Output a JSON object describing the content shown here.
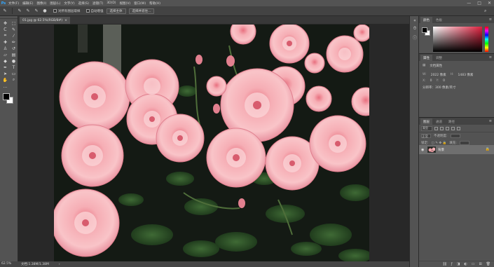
{
  "menubar": {
    "logo": "Ps",
    "items": [
      "文件(F)",
      "编辑(E)",
      "图像(I)",
      "图层(L)",
      "文字(Y)",
      "选择(S)",
      "滤镜(T)",
      "3D(D)",
      "视图(V)",
      "窗口(W)",
      "帮助(H)"
    ],
    "window_controls": [
      "—",
      "□",
      "✕"
    ]
  },
  "options": {
    "sample_all_layers_label": "对所有图层取样",
    "enhance_edge_label": "自动增强",
    "select_subject_label": "选择主体",
    "select_and_mask_label": "选择并遮住..."
  },
  "document": {
    "tab_title": "01.jpg @ 62.5%(RGB/8#)",
    "close_glyph": "×",
    "zoom": "62.5%",
    "doc_info": "文档:1.38M/1.38M"
  },
  "panels": {
    "color": {
      "tabs": [
        "颜色",
        "色板"
      ]
    },
    "properties": {
      "tabs": [
        "属性",
        "调整"
      ],
      "type_label": "文档属性",
      "w_label": "W:",
      "w_value": "2022 像素",
      "h_label": "H:",
      "h_value": "1483 像素",
      "x_label": "X:",
      "x_value": "0",
      "y_label": "Y:",
      "y_value": "0",
      "resolution": "分辨率：300 像素/英寸"
    },
    "layers": {
      "tabs": [
        "图层",
        "通道",
        "路径"
      ],
      "filter_label": "类型",
      "blend_label": "正常",
      "opacity_label": "不透明度:",
      "lock_label": "锁定:",
      "fill_label": "填充:",
      "layer_name": "背景"
    }
  },
  "colors": {
    "accent": "#31a8ff",
    "workspace": "#282828",
    "panel": "#535353",
    "selected_layer": "#6f6f6f",
    "rose_pink": "#f2a3aa",
    "foliage": "#1e3a1f"
  }
}
